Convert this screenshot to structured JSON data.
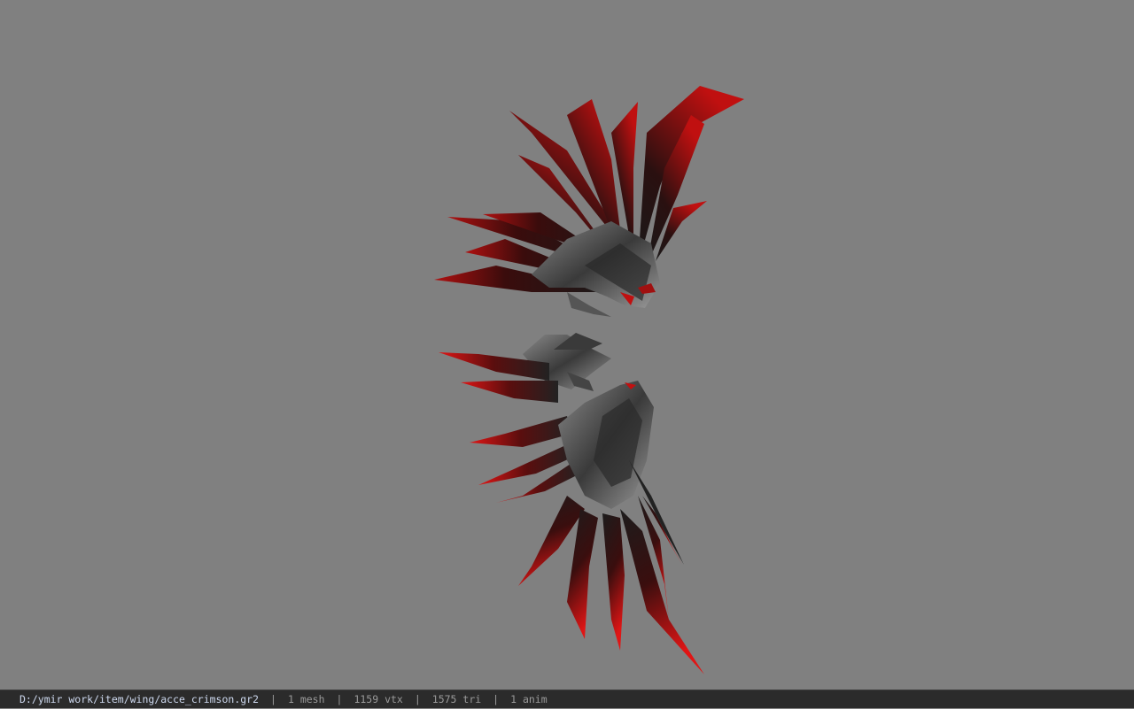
{
  "viewer": {
    "background_color": "#808080",
    "model": {
      "icon": "wing-model",
      "colors": {
        "feather_red": "#d01010",
        "feather_dark": "#1a1a1a",
        "metal": "#6c6c6c"
      }
    }
  },
  "status": {
    "file_path": "D:/ymir work/item/wing/acce_crimson.gr2",
    "separator": "|",
    "mesh": "1 mesh",
    "vertices": "1159 vtx",
    "triangles": "1575 tri",
    "animations": "1 anim"
  }
}
